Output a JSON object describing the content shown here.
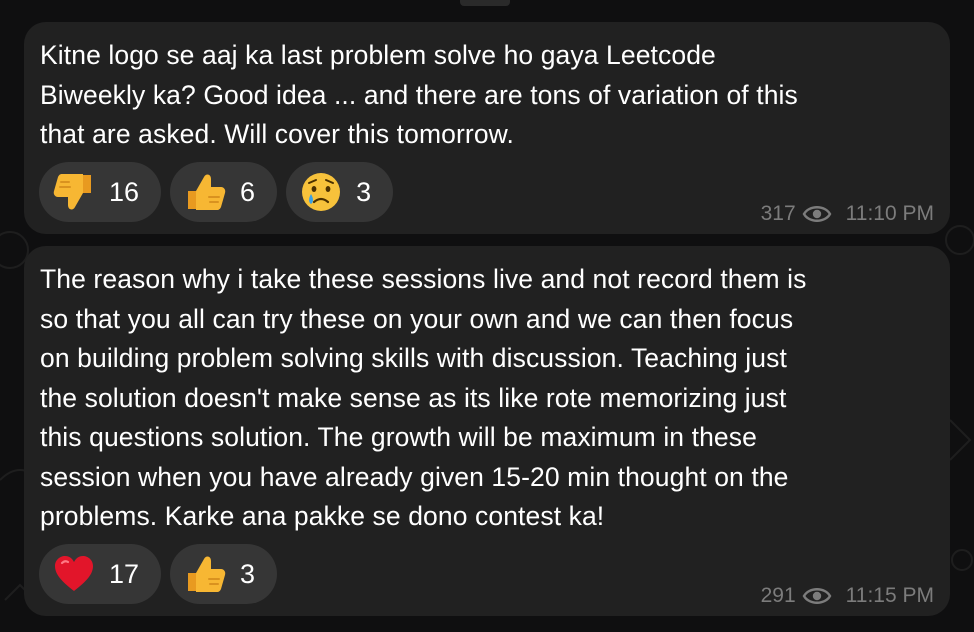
{
  "messages": [
    {
      "text": "Kitne logo se aaj ka last problem solve ho gaya Leetcode\nBiweekly ka? Good idea ... and there are tons of variation of this\nthat are asked. Will cover this tomorrow.",
      "reactions": [
        {
          "emoji": "thumbs-down",
          "count": "16"
        },
        {
          "emoji": "thumbs-up",
          "count": "6"
        },
        {
          "emoji": "crying-face",
          "count": "3"
        }
      ],
      "views": "317",
      "time": "11:10 PM"
    },
    {
      "text": "The reason why i take these sessions live and not record them is\nso that you all can try these on your own and we can then focus\non building problem solving skills with discussion. Teaching just\nthe solution doesn't make sense as its like rote memorizing just\nthis questions solution. The growth will be maximum in these\nsession when you have already given 15-20 min thought on the\nproblems. Karke ana pakke se dono contest ka!",
      "reactions": [
        {
          "emoji": "red-heart",
          "count": "17"
        },
        {
          "emoji": "thumbs-up",
          "count": "3"
        }
      ],
      "views": "291",
      "time": "11:15 PM"
    }
  ],
  "colors": {
    "background": "#0f0f10",
    "bubble": "#212121",
    "reaction_pill": "#363636",
    "text": "#ffffff",
    "meta_text": "#7c7c7c",
    "thumb": "#f7b733",
    "heart": "#e2152a"
  }
}
